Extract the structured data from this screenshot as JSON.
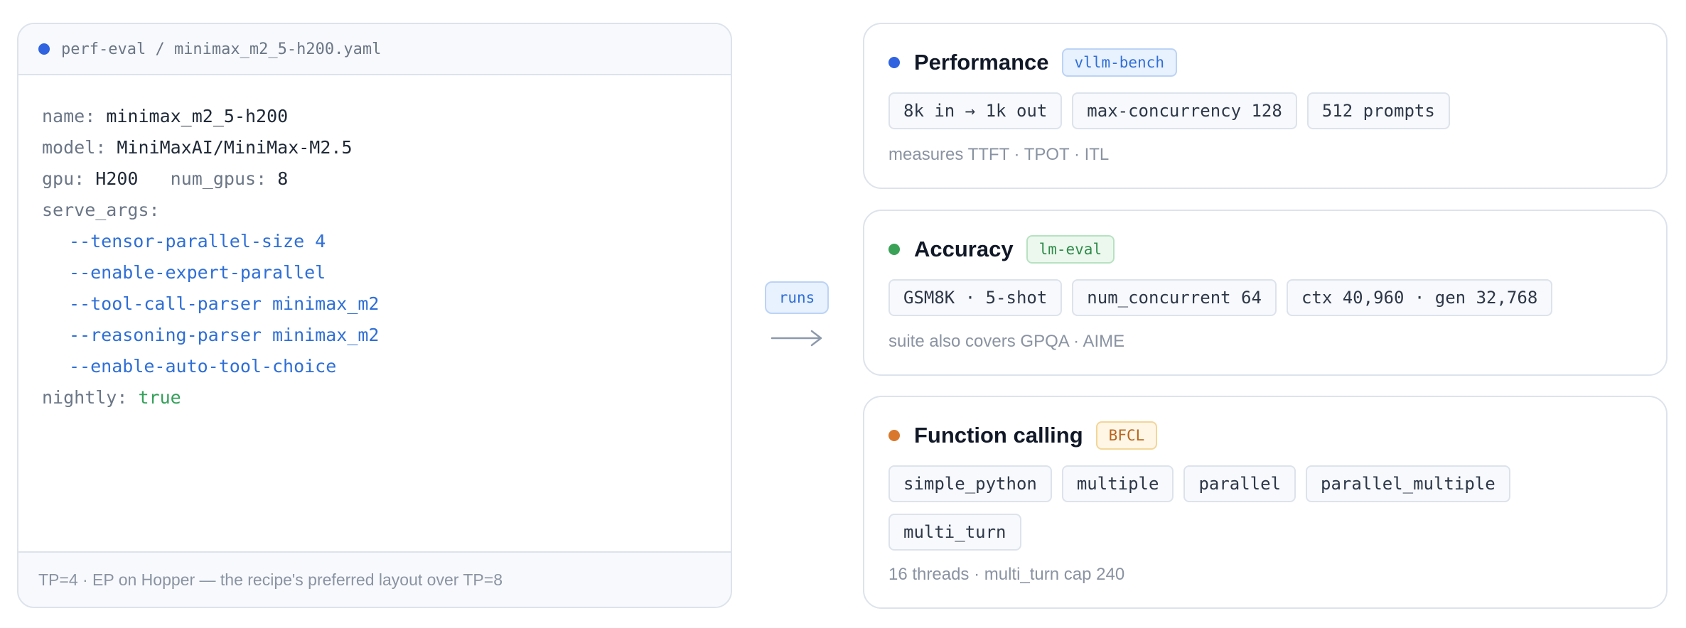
{
  "config": {
    "header": "perf-eval / minimax_m2_5-h200.yaml",
    "dot_color": "#2f63e0",
    "lines": {
      "name_key": "name:",
      "name_value": "minimax_m2_5-h200",
      "model_key": "model:",
      "model_value": "MiniMaxAI/MiniMax-M2.5",
      "gpu_key": "gpu:",
      "gpu_value": "H200",
      "num_gpus_key": "num_gpus:",
      "num_gpus_value": "8",
      "serve_args_key": "serve_args:",
      "serve_args": [
        "--tensor-parallel-size 4",
        "--enable-expert-parallel",
        "--tool-call-parser minimax_m2",
        "--reasoning-parser minimax_m2",
        "--enable-auto-tool-choice"
      ],
      "nightly_key": "nightly:",
      "nightly_value": "true"
    },
    "footer": "TP=4 · EP on Hopper — the recipe's preferred layout over TP=8"
  },
  "connector": {
    "label": "runs"
  },
  "cards": [
    {
      "title": "Performance",
      "badge": "vllm-bench",
      "dot_color": "#2f63e0",
      "badge_bg": "#e8f1fe",
      "badge_border": "#bcd3f5",
      "badge_text": "#2f6fd6",
      "chips": [
        "8k in → 1k out",
        "max-concurrency 128",
        "512 prompts"
      ],
      "note": "measures TTFT · TPOT · ITL"
    },
    {
      "title": "Accuracy",
      "badge": "lm-eval",
      "dot_color": "#3aa257",
      "badge_bg": "#ecf8ee",
      "badge_border": "#b7e2c2",
      "badge_text": "#2f8a4a",
      "chips": [
        "GSM8K · 5-shot",
        "num_concurrent 64",
        "ctx 40,960 · gen 32,768"
      ],
      "note": "suite also covers GPQA · AIME"
    },
    {
      "title": "Function calling",
      "badge": "BFCL",
      "dot_color": "#d9782d",
      "badge_bg": "#fff6e6",
      "badge_border": "#f3d698",
      "badge_text": "#b8651c",
      "chips": [
        "simple_python",
        "multiple",
        "parallel",
        "parallel_multiple",
        "multi_turn"
      ],
      "note": "16 threads · multi_turn cap 240"
    }
  ]
}
